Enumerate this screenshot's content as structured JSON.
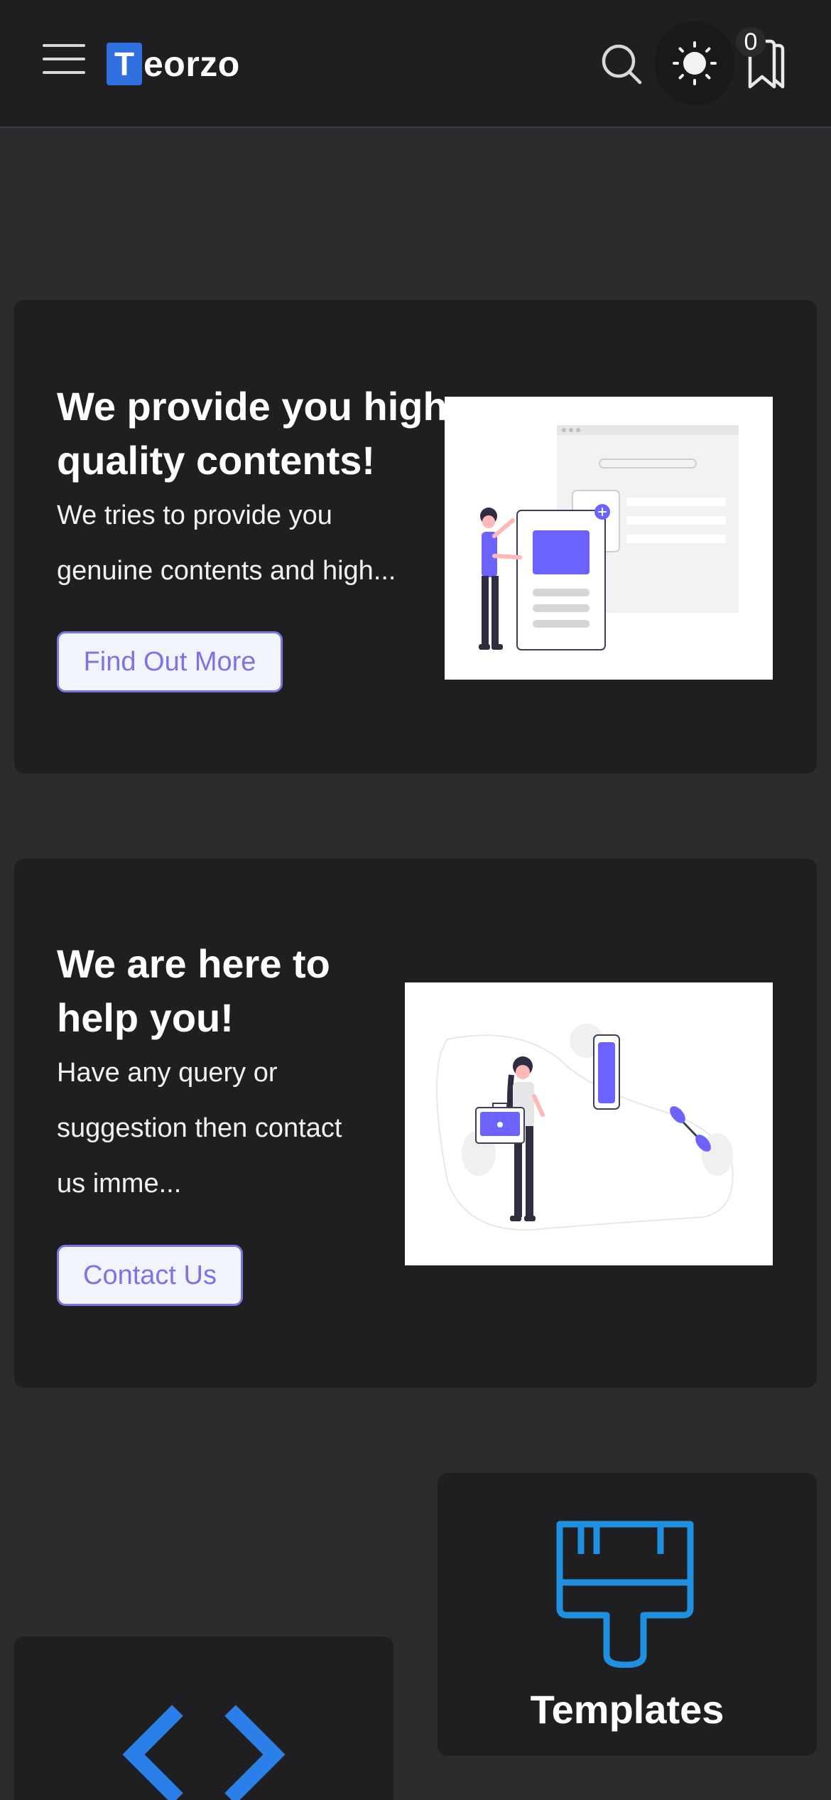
{
  "header": {
    "logo_letter": "T",
    "logo_text": "eorzo",
    "bookmark_count": "0",
    "icons": [
      "menu-icon",
      "search-icon",
      "sun-icon",
      "bookmark-icon"
    ]
  },
  "hero_cards": [
    {
      "title_line1": "We provide you high",
      "title_line2": "quality contents!",
      "text_line1": "We tries to provide you",
      "text_line2": "genuine contents and high...",
      "button": "Find Out More"
    },
    {
      "title_line1": "We are here to",
      "title_line2": "help you!",
      "text_line1": "Have any query or",
      "text_line2": "suggestion then contact",
      "text_line3": "us imme...",
      "button": "Contact Us"
    }
  ],
  "features": [
    {
      "title": "Templates",
      "icon": "paintbrush-icon"
    },
    {
      "title": "",
      "icon": "code-icon"
    }
  ],
  "colors": {
    "accent": "#7b74e4",
    "logo_blue": "#2f6fde",
    "feature_icon_blue": "#1f8fe0",
    "background": "#2c2c2f",
    "card": "#1f1f21"
  }
}
